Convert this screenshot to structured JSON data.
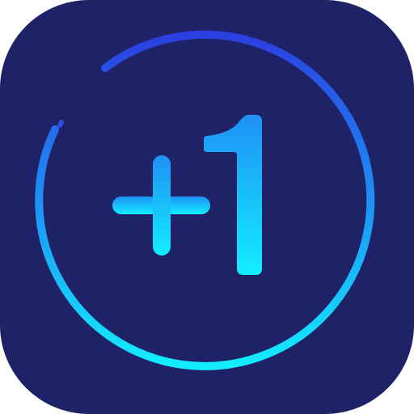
{
  "app_icon": {
    "glyph": "+1",
    "colors": {
      "background": "#202268",
      "gradient_top": "#2B3FE0",
      "gradient_mid": "#1E90F5",
      "gradient_bottom": "#12EEFF"
    },
    "icon_names": [
      "plus-icon",
      "ring-arc-icon"
    ]
  }
}
